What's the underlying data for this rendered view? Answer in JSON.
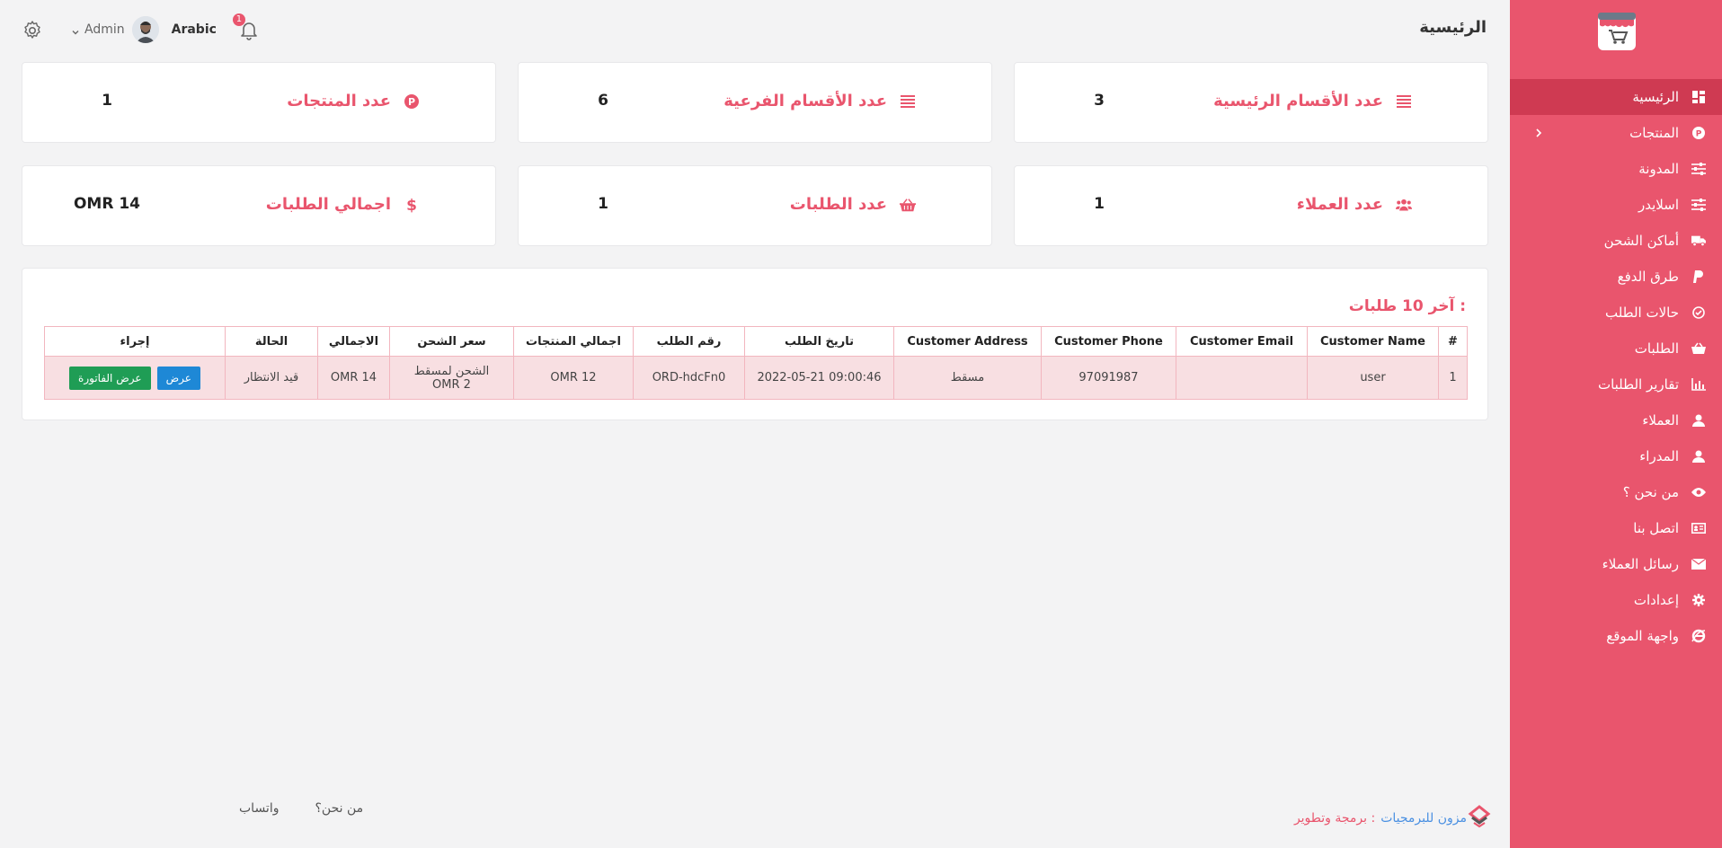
{
  "sidebar": {
    "items": [
      {
        "label": "الرئيسية",
        "icon": "dashboard-icon",
        "active": true
      },
      {
        "label": "المنتجات",
        "icon": "products-p-icon",
        "has_chevron": true
      },
      {
        "label": "المدونة",
        "icon": "sliders-icon"
      },
      {
        "label": "اسلايدر",
        "icon": "sliders-icon"
      },
      {
        "label": "أماكن الشحن",
        "icon": "truck-icon"
      },
      {
        "label": "طرق الدفع",
        "icon": "paypal-icon"
      },
      {
        "label": "حالات الطلب",
        "icon": "check-circle-icon"
      },
      {
        "label": "الطلبات",
        "icon": "basket-icon"
      },
      {
        "label": "تقارير الطلبات",
        "icon": "chart-icon"
      },
      {
        "label": "العملاء",
        "icon": "user-icon"
      },
      {
        "label": "المدراء",
        "icon": "user-icon"
      },
      {
        "label": "من نحن ؟",
        "icon": "eye-icon"
      },
      {
        "label": "اتصل بنا",
        "icon": "contact-card-icon"
      },
      {
        "label": "رسائل العملاء",
        "icon": "envelope-icon"
      },
      {
        "label": "إعدادات",
        "icon": "gear-icon"
      },
      {
        "label": "واجهة الموقع",
        "icon": "internet-explorer-icon"
      }
    ]
  },
  "header": {
    "title": "الرئيسية",
    "language": "Arabic",
    "user_name": "Admin",
    "notification_count": "1"
  },
  "stats": [
    {
      "label": "عدد الأقسام الرئيسية",
      "value": "3",
      "icon": "list-icon"
    },
    {
      "label": "عدد الأقسام الفرعية",
      "value": "6",
      "icon": "list-icon"
    },
    {
      "label": "عدد المنتجات",
      "value": "1",
      "icon": "products-p-icon"
    },
    {
      "label": "عدد العملاء",
      "value": "1",
      "icon": "users-icon"
    },
    {
      "label": "عدد الطلبات",
      "value": "1",
      "icon": "basket-icon"
    },
    {
      "label": "اجمالي الطلبات",
      "value": "OMR 14",
      "icon": "dollar-icon"
    }
  ],
  "orders": {
    "title": "آخر 10 طلبات :",
    "columns": [
      "#",
      "Customer Name",
      "Customer Email",
      "Customer Phone",
      "Customer Address",
      "تاريخ الطلب",
      "رقم الطلب",
      "اجمالي المنتجات",
      "سعر الشحن",
      "الاجمالي",
      "الحالة",
      "إجراء"
    ],
    "rows": [
      {
        "num": "1",
        "name": "user",
        "email": "",
        "phone": "97091987",
        "address": "مسقط",
        "date": "2022-05-21 09:00:46",
        "order_no": "ORD-hdcFn0",
        "products_total": "OMR 12",
        "shipping_line1": "الشحن لمسقط",
        "shipping_line2": "OMR 2",
        "total": "OMR 14",
        "status": "قيد الانتظار",
        "view_label": "عرض",
        "invoice_label": "عرض الفاتورة"
      }
    ]
  },
  "footer": {
    "credit_label": "برمجة وتطوير :",
    "credit_company": "مزون للبرمجيات",
    "link_about": "من نحن؟",
    "link_whatsapp": "واتساب"
  },
  "colors": {
    "brand": "#e9556d",
    "brand_dark": "#cf3a52",
    "view_button": "#1e88d6",
    "invoice_button": "#1f9d55"
  }
}
